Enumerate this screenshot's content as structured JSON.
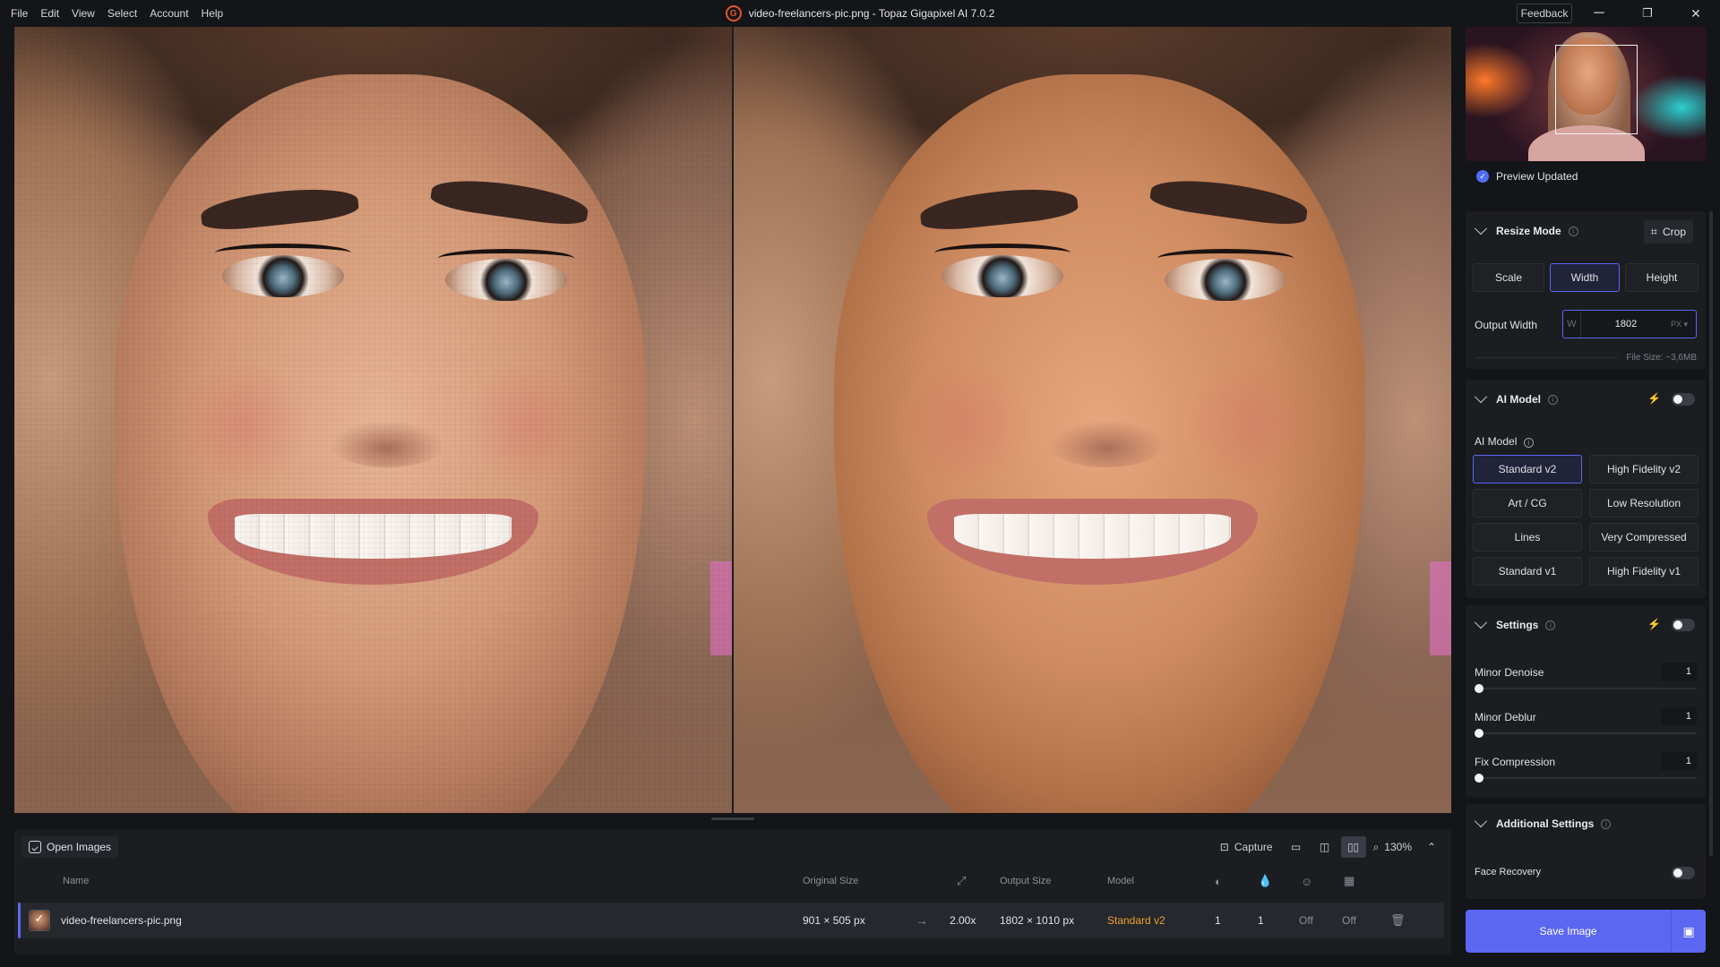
{
  "menu": [
    "File",
    "Edit",
    "View",
    "Select",
    "Account",
    "Help"
  ],
  "window": {
    "title": "video-freelancers-pic.png - Topaz Gigapixel AI 7.0.2",
    "logo_letter": "G",
    "feedback": "Feedback",
    "minimize": "─",
    "restore": "❐",
    "close": "✕"
  },
  "bottom": {
    "open_images": "Open Images",
    "capture": "Capture",
    "zoom": "130%",
    "columns": {
      "name": "Name",
      "original_size": "Original Size",
      "output_size": "Output Size",
      "model": "Model"
    },
    "row": {
      "name": "video-freelancers-pic.png",
      "original_size": "901 × 505 px",
      "arrow": "→",
      "scale": "2.00x",
      "output_size": "1802 × 1010 px",
      "model": "Standard v2",
      "denoise": "1",
      "deblur": "1",
      "face": "Off",
      "compression": "Off"
    }
  },
  "right_panel": {
    "preview_status": "Preview Updated",
    "resize_mode": {
      "title": "Resize Mode",
      "crop": "Crop",
      "modes": [
        "Scale",
        "Width",
        "Height"
      ],
      "active_mode": "Width",
      "output_width_label": "Output Width",
      "w_prefix": "W",
      "output_width_value": "1802",
      "unit": "PX ▾",
      "file_size": "File Size: ~3,6MB"
    },
    "ai_model": {
      "title": "AI Model",
      "subtitle": "AI Model",
      "models": [
        "Standard v2",
        "High Fidelity v2",
        "Art / CG",
        "Low Resolution",
        "Lines",
        "Very Compressed",
        "Standard v1",
        "High Fidelity v1"
      ],
      "active_model": "Standard v2"
    },
    "settings": {
      "title": "Settings",
      "sliders": [
        {
          "label": "Minor Denoise",
          "value": "1"
        },
        {
          "label": "Minor Deblur",
          "value": "1"
        },
        {
          "label": "Fix Compression",
          "value": "1"
        }
      ]
    },
    "additional": {
      "title": "Additional Settings",
      "face_recovery": "Face Recovery"
    },
    "save": "Save Image"
  },
  "colors": {
    "accent": "#5b67f0",
    "model_text": "#f0a030",
    "background": "#141518",
    "panel": "#1b1d21"
  }
}
